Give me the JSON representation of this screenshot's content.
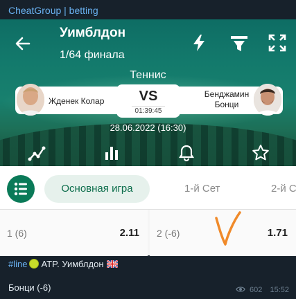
{
  "channel": {
    "name": "CheatGroup | betting"
  },
  "match": {
    "title": "Уимблдон",
    "round": "1/64 финала",
    "sport": "Теннис",
    "player1": "Жденек Колар",
    "player2_line1": "Бенджамин",
    "player2_line2": "Бонци",
    "vs": "VS",
    "timer": "01:39:45",
    "datetime": "28.06.2022 (16:30)"
  },
  "tabs": {
    "active": "Основная игра",
    "second": "1-й Сет",
    "third": "2-й С"
  },
  "odds": {
    "left_label": "1 (6)",
    "left_value": "2.11",
    "right_label": "2 (-6)",
    "right_value": "1.71"
  },
  "message": {
    "hashtag": "#line",
    "league": "ATP. Уимблдон",
    "pick": "Бонци (-6)",
    "views": "602",
    "time": "15:52"
  },
  "colors": {
    "accent": "#0c6d4b",
    "link": "#6ab2f2",
    "background": "#17212b"
  },
  "icons": [
    "back-arrow-icon",
    "lightning-icon",
    "filter-icon",
    "expand-icon",
    "stats-line-icon",
    "bar-chart-icon",
    "bell-icon",
    "star-icon",
    "list-menu-icon",
    "tennis-ball-icon",
    "uk-flag-icon",
    "eye-icon"
  ]
}
